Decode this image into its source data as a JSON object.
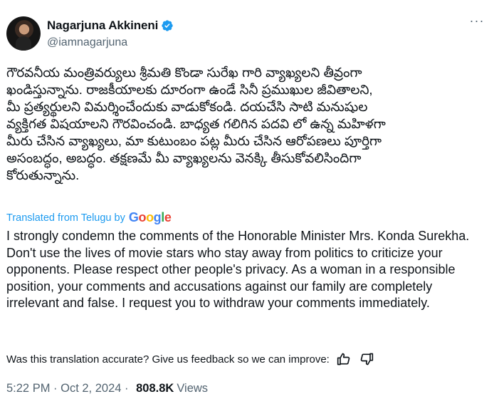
{
  "author": {
    "display_name": "Nagarjuna Akkineni",
    "handle": "@iamnagarjuna",
    "verified_icon": "verified-badge-icon"
  },
  "tweet": {
    "original_text": "గౌరవనీయ మంత్రివర్యులు శ్రీమతి కొండా సురేఖ గారి వ్యాఖ్యలని తీవ్రంగా\nఖండిస్తున్నాను. రాజకీయాలకు దూరంగా ఉండే సినీ ప్రముఖుల జీవితాలని,\nమీ ప్రత్యర్థులని విమర్శించేందుకు వాడుకోకండి. దయచేసి సాటి మనుషుల\nవ్యక్తిగత విషయాలని  గౌరవించండి. బాధ్యత గలిగిన పదవి లో ఉన్న మహిళగా\nమీరు చేసిన వ్యాఖ్యలు, మా కుటుంబం పట్ల మీరు చేసిన ఆరోపణలు పూర్తిగా\nఅసంబద్ధం, అబద్ధం. తక్షణమే మీ వ్యాఖ్యలను వెనక్కి తీసుకోవలిసిందిగా\nకోరుతున్నాను.",
    "translated_label": "Translated from Telugu by",
    "translator": "Google",
    "translation": "I strongly condemn the comments of the Honorable Minister Mrs. Konda Surekha. Don't use the lives of movie stars who stay away from politics to criticize your opponents. Please respect other people's privacy. As a woman in a responsible position, your comments and accusations against our family are completely irrelevant and false. I request you to withdraw your comments immediately.",
    "feedback_prompt": "Was this translation accurate? Give us feedback so we can improve:",
    "time": "5:22 PM",
    "separator": " · ",
    "date": "Oct 2, 2024",
    "views_count": "808.8K",
    "views_label": "Views"
  },
  "colors": {
    "link": "#1d9bf0",
    "secondary_text": "#536471",
    "primary_text": "#0f1419"
  }
}
